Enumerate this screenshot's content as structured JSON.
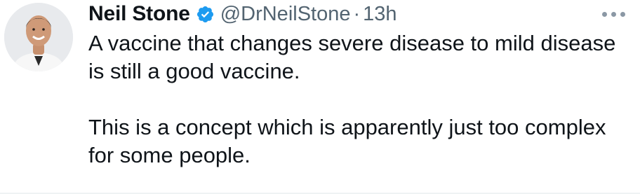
{
  "tweet": {
    "author_name": "Neil Stone",
    "handle": "@DrNeilStone",
    "separator": "·",
    "timestamp": "13h",
    "verified_icon": "verified-badge-icon",
    "more_icon": "more-options-icon",
    "paragraphs": [
      "A vaccine that changes severe disease to mild disease is still a good vaccine.",
      "This is a concept which is apparently just too complex for some people."
    ]
  },
  "colors": {
    "verified": "#1d9bf0",
    "text": "#0f1419",
    "muted": "#536471"
  }
}
